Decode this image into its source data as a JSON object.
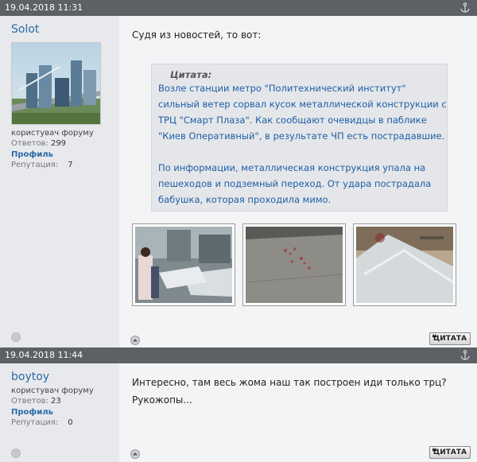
{
  "posts": [
    {
      "date": "19.04.2018 11:31",
      "author": {
        "name": "Solot",
        "rank": "користувач форуму",
        "posts_label": "Ответов:",
        "posts_value": "299",
        "profile_label": "Профиль",
        "rep_label": "Репутация:",
        "rep_value": "7"
      },
      "intro": "Судя из новостей, то вот:",
      "quote": {
        "title": "Цитата:",
        "para1": "Возле станции метро \"Политехнический институт\" сильный ветер сорвал кусок металлической конструкции с ТРЦ \"Смарт Плаза\". Как сообщают очевидцы в паблике \"Киев Оперативный\", в результате ЧП есть пострадавшие.",
        "para2": "По информации, металлическая конструкция упала на пешеходов и подземный переход. От удара пострадала бабушка, которая проходила мимо."
      },
      "quote_button": "ЦИТАТА"
    },
    {
      "date": "19.04.2018 11:44",
      "author": {
        "name": "boytoy",
        "rank": "користувач форуму",
        "posts_label": "Ответов:",
        "posts_value": "23",
        "profile_label": "Профиль",
        "rep_label": "Репутация:",
        "rep_value": "0"
      },
      "line1": "Интересно, там весь жома наш так построен иди только трц?",
      "line2": "Рукожопы...",
      "quote_button": "ЦИТАТА"
    }
  ],
  "colors": {
    "header": "#5d6064",
    "author_bg": "#e8e9ec",
    "link": "#2b6aa8",
    "quote_text": "#1e5fa5"
  }
}
